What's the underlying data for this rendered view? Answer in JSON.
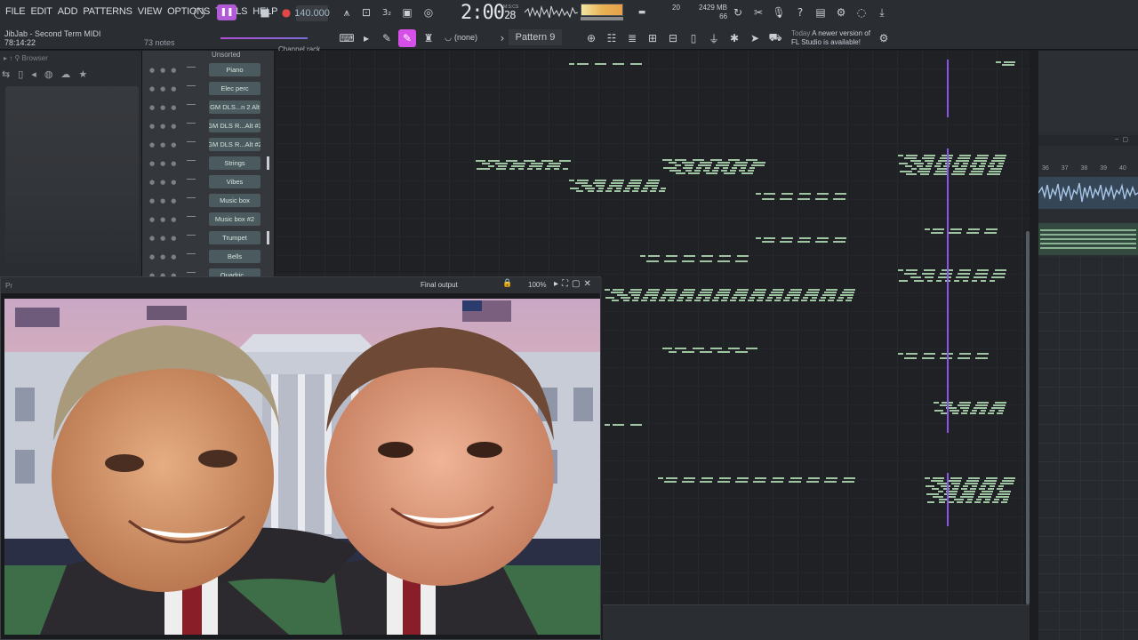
{
  "menu": [
    "FILE",
    "EDIT",
    "ADD",
    "PATTERNS",
    "VIEW",
    "OPTIONS",
    "TOOLS",
    "HELP"
  ],
  "project": {
    "name": "JibJab - Second Term MIDI",
    "position": "78:14:22",
    "notes": "73 notes"
  },
  "transport": {
    "tempo": "140.000",
    "time": "2:00",
    "time_small": "28",
    "mics": "M:S:CS"
  },
  "monitor": {
    "cpu": "20",
    "memory": "2429 MB",
    "polyphony": "66"
  },
  "pattern": "Pattern 9",
  "snap": "(none)",
  "news": {
    "label": "Today",
    "text_line1": "A newer version of",
    "text_line2": "FL Studio is available!"
  },
  "browser": {
    "title": "Browser"
  },
  "rack": {
    "header": "Unsorted",
    "tab": "Channel rack",
    "channels": [
      "Piano",
      "Elec perc",
      "GM DLS...n 2 Alt",
      "GM DLS R...Alt #3",
      "GM DLS R...Alt #2",
      "Strings",
      "Vibes",
      "Music box",
      "Music box #2",
      "Trumpet",
      "Bells",
      "Quadric..."
    ]
  },
  "video": {
    "prefix": "Pr",
    "title": "Final output",
    "zoom": "100%"
  },
  "playlist": {
    "bar_numbers": [
      "36",
      "37",
      "38",
      "39",
      "40"
    ]
  },
  "colors": {
    "note": "#9ec4a2",
    "playhead": "#8a55e8",
    "accent": "#d64fe8"
  }
}
